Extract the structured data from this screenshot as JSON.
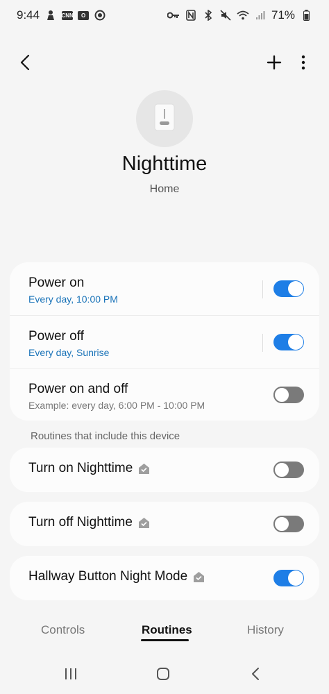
{
  "status_bar": {
    "time": "9:44",
    "battery": "71%",
    "left_icons": [
      "person-icon",
      "cnn-icon",
      "outlook-icon",
      "target-icon"
    ],
    "right_icons": [
      "key-icon",
      "nfc-icon",
      "bluetooth-icon",
      "mute-icon",
      "wifi-icon",
      "signal-icon",
      "battery-icon"
    ]
  },
  "header": {
    "back_icon": "chevron-left-icon",
    "add_icon": "plus-icon",
    "more_icon": "more-vertical-icon"
  },
  "device": {
    "icon": "light-switch-icon",
    "name": "Nighttime",
    "location": "Home"
  },
  "schedules": [
    {
      "title": "Power on",
      "subtitle": "Every day, 10:00 PM",
      "enabled": true
    },
    {
      "title": "Power off",
      "subtitle": "Every day, Sunrise",
      "enabled": true
    },
    {
      "title": "Power on and off",
      "subtitle": "Example: every day, 6:00 PM - 10:00 PM",
      "enabled": false
    }
  ],
  "routines_section_label": "Routines that include this device",
  "routines": [
    {
      "title": "Turn on Nighttime",
      "badge_icon": "home-badge-icon",
      "enabled": false
    },
    {
      "title": "Turn off Nighttime",
      "badge_icon": "home-badge-icon",
      "enabled": false
    },
    {
      "title": "Hallway Button Night Mode",
      "badge_icon": "home-badge-icon",
      "enabled": true
    }
  ],
  "tabs": [
    {
      "label": "Controls",
      "active": false
    },
    {
      "label": "Routines",
      "active": true
    },
    {
      "label": "History",
      "active": false
    }
  ],
  "nav": {
    "recents_icon": "recents-icon",
    "home_icon": "home-button-icon",
    "back_icon": "back-icon"
  },
  "colors": {
    "accent": "#1e7ee6",
    "subtitle_blue": "#1a73b8",
    "background": "#f5f5f5",
    "card": "#fcfcfc"
  }
}
